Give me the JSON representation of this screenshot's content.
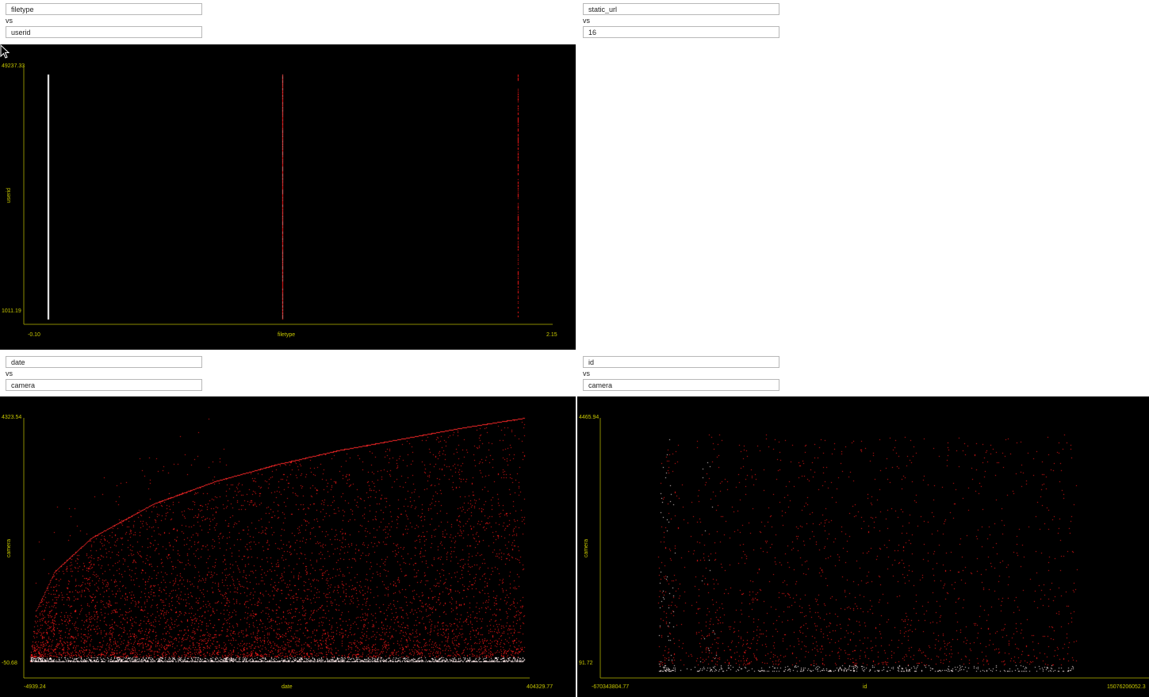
{
  "panels": [
    {
      "x_field": "filetype",
      "vs_label": "vs",
      "y_field": "userid",
      "plot": {
        "y_max_label": "49237.33",
        "y_min_label": "1011.19",
        "x_min_label": "-0.10",
        "x_max_label": "2.15",
        "x_axis_label": "filetype",
        "y_axis_label": "userid"
      }
    },
    {
      "x_field": "static_url",
      "vs_label": "vs",
      "y_field": "16"
    },
    {
      "x_field": "date",
      "vs_label": "vs",
      "y_field": "camera",
      "plot": {
        "y_max_label": "4323.54",
        "y_min_label": "-50.68",
        "x_min_label": "-4939.24",
        "x_max_label": "404329.77",
        "x_axis_label": "date",
        "y_axis_label": "camera"
      }
    },
    {
      "x_field": "id",
      "vs_label": "vs",
      "y_field": "camera",
      "plot": {
        "y_max_label": "4465.94",
        "y_min_label": "91.72",
        "x_min_label": "-670343804.77",
        "x_max_label": "15076206052.3",
        "x_axis_label": "id",
        "y_axis_label": "camera"
      }
    }
  ],
  "colors": {
    "background": "#000000",
    "axis": "#8a8a00",
    "label": "#c8c800",
    "point": "#ff1a1a",
    "dense": "#ffffff"
  },
  "chart_data": [
    {
      "type": "scatter",
      "title": "",
      "xlabel": "filetype",
      "ylabel": "userid",
      "xlim": [
        -0.1,
        2.15
      ],
      "ylim": [
        1011.19,
        49237.33
      ],
      "x_categories_values": [
        0,
        1,
        2
      ],
      "series": [
        {
          "x": 0,
          "y_range": [
            1011.19,
            49237.33
          ],
          "density": "very high"
        },
        {
          "x": 1,
          "y_range": [
            1011.19,
            49237.33
          ],
          "density": "high"
        },
        {
          "x": 2,
          "y_range": [
            1011.19,
            49237.33
          ],
          "density": "sparse"
        }
      ]
    },
    {
      "type": "scatter",
      "title": "",
      "xlabel": "date",
      "ylabel": "camera",
      "xlim": [
        -4939.24,
        404329.77
      ],
      "ylim": [
        -50.68,
        4323.54
      ],
      "envelope_x": [
        0,
        5000,
        20000,
        50000,
        100000,
        150000,
        200000,
        250000,
        300000,
        350000,
        400000
      ],
      "envelope_y": [
        0,
        900,
        1600,
        2200,
        2800,
        3200,
        3500,
        3750,
        3950,
        4150,
        4323
      ]
    },
    {
      "type": "scatter",
      "title": "",
      "xlabel": "id",
      "ylabel": "camera",
      "xlim": [
        -670343804.77,
        15076206052.3
      ],
      "ylim": [
        91.72,
        4465.94
      ],
      "x_extent": [
        1000000000,
        13000000000
      ]
    }
  ]
}
